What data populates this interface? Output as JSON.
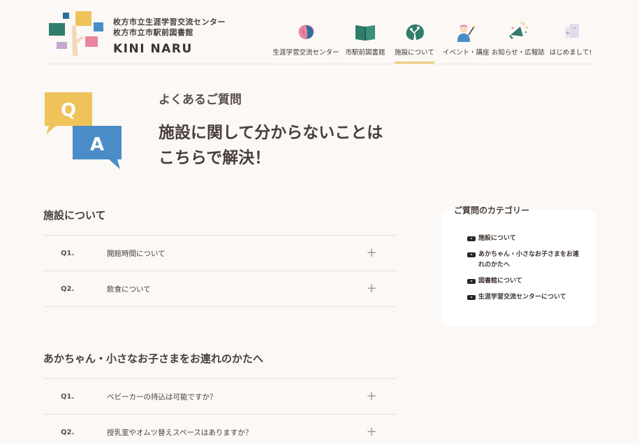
{
  "header": {
    "logo_line1": "枚方市立生涯学習交流センター",
    "logo_line2": "枚方市立市駅前図書館",
    "brand": "KINI NARU"
  },
  "nav": {
    "items": [
      {
        "label": "生涯学習交流センター",
        "icon": "brain-icon",
        "active": false
      },
      {
        "label": "市駅前図書館",
        "icon": "book-icon",
        "active": false
      },
      {
        "label": "施設について",
        "icon": "tree-icon",
        "active": true
      },
      {
        "label": "イベント・講座",
        "icon": "lecturer-icon",
        "active": false
      },
      {
        "label": "お知らせ・広報誌",
        "icon": "megaphone-icon",
        "active": false
      },
      {
        "label": "はじめまして!",
        "icon": "sparkle-cards-icon",
        "active": false
      }
    ],
    "accent": "#f1cd83"
  },
  "hero": {
    "kicker": "よくあるご質問",
    "title_line1": "施設に関して分からないことは",
    "title_line2": "こちらで解決！",
    "qa_q": "Q",
    "qa_a": "A"
  },
  "sections": [
    {
      "title": "施設について",
      "items": [
        {
          "num": "Q1.",
          "question": "開館時間について"
        },
        {
          "num": "Q2.",
          "question": "飲食について"
        }
      ]
    },
    {
      "title": "あかちゃん・小さなお子さまをお連れのかたへ",
      "items": [
        {
          "num": "Q1.",
          "question": "ベビーカーの持込は可能ですか？"
        },
        {
          "num": "Q2.",
          "question": "授乳室やオムツ替えスペースはありますか？"
        }
      ]
    }
  ],
  "sidebar": {
    "title": "ご質問のカテゴリー",
    "categories": [
      "施設について",
      "あかちゃん・小さなお子さまをお連れのかたへ",
      "図書館について",
      "生涯学習交流センターについて"
    ]
  },
  "icons": {
    "plus": "+"
  }
}
